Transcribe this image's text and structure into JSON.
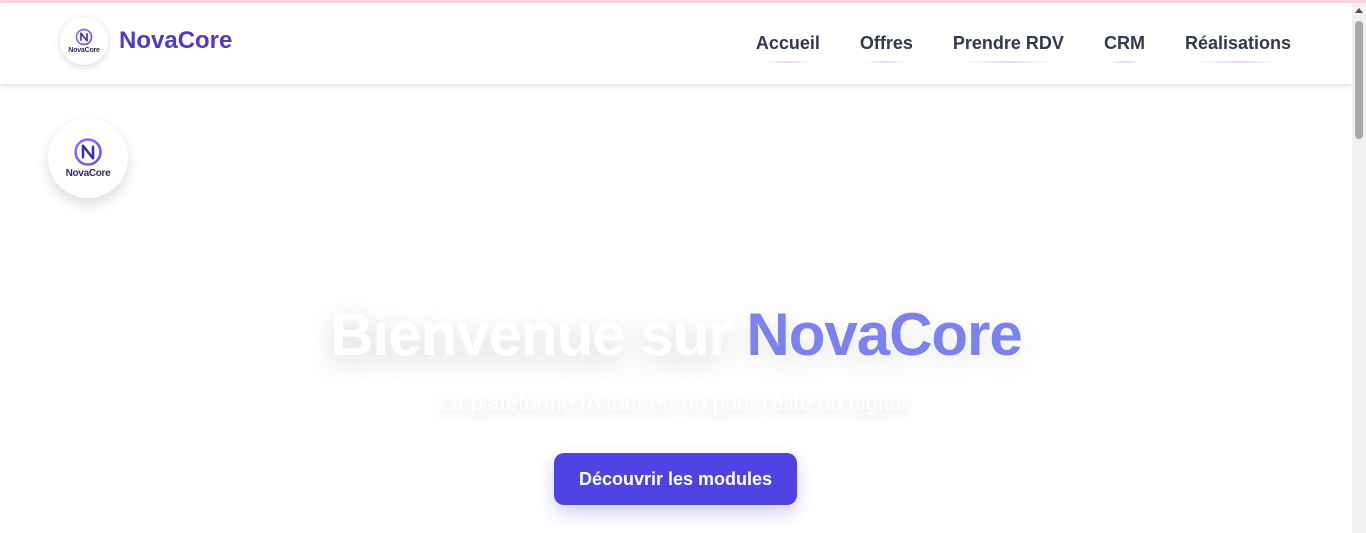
{
  "brand": {
    "name": "NovaCore",
    "logo_text": "NovaCore",
    "logo_monogram": "N"
  },
  "nav": {
    "items": [
      {
        "label": "Accueil"
      },
      {
        "label": "Offres"
      },
      {
        "label": "Prendre RDV"
      },
      {
        "label": "CRM"
      },
      {
        "label": "Réalisations"
      }
    ]
  },
  "hero": {
    "title_main": "Bienvenue sur",
    "title_accent": "NovaCore",
    "subtitle": "La plateforme IA tout-en-un pour l'élite du digital.",
    "cta_label": "Découvrir les modules"
  },
  "colors": {
    "brand": "#4b3bc8",
    "accent": "#7b82f0",
    "cta": "#4f43e3",
    "nav_text": "#333a4d"
  }
}
